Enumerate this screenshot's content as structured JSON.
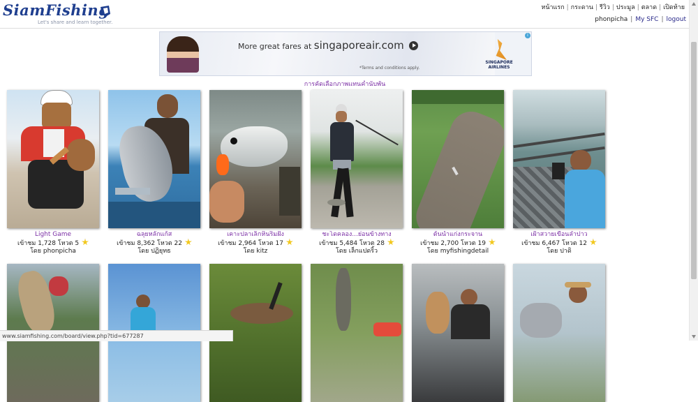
{
  "header": {
    "logo_text": "SiamFishing",
    "tagline": "Let's share and learn together.",
    "nav": [
      "หน้าแรก",
      "กระดาน",
      "รีวิว",
      "ประมูล",
      "ตลาด",
      "เปิดท้าย"
    ],
    "username": "phonpicha",
    "my_sfc": "My SFC",
    "logout": "logout"
  },
  "ad": {
    "tagline": "More great fares at",
    "brand": "singaporeair.com",
    "terms": "*Terms and conditions apply.",
    "airline_line1": "SINGAPORE",
    "airline_line2": "AIRLINES"
  },
  "section_title": "การคัดเลือกภาพแทนคำนับพัน",
  "cards": [
    {
      "title": "Light Game",
      "views": "1,728",
      "votes": "5",
      "author": "phonpicha"
    },
    {
      "title": "ฉลุยหลักแก้ส",
      "views": "8,362",
      "votes": "22",
      "author": "ปฏิยุทธ"
    },
    {
      "title": "เคาะปลาเล็กหินริมฝั่ง",
      "views": "2,964",
      "votes": "17",
      "author": "kitz"
    },
    {
      "title": "ชะโดคลอง...ย่อนข้างทาง",
      "views": "5,484",
      "votes": "28",
      "author": "เล็กแปดริ้ว"
    },
    {
      "title": "ต้นน้ำแก่งกระจาน",
      "views": "2,700",
      "votes": "19",
      "author": "myfishingdetail"
    },
    {
      "title": "เฝ้าสวายเขื่อนลำปาว",
      "views": "6,467",
      "votes": "12",
      "author": "ปาดิ"
    }
  ],
  "labels": {
    "views_prefix": "เข้าชม",
    "votes_prefix": "โหวต",
    "by_prefix": "โดย"
  },
  "statusbar": "www.siamfishing.com/board/view.php?tid=677287"
}
